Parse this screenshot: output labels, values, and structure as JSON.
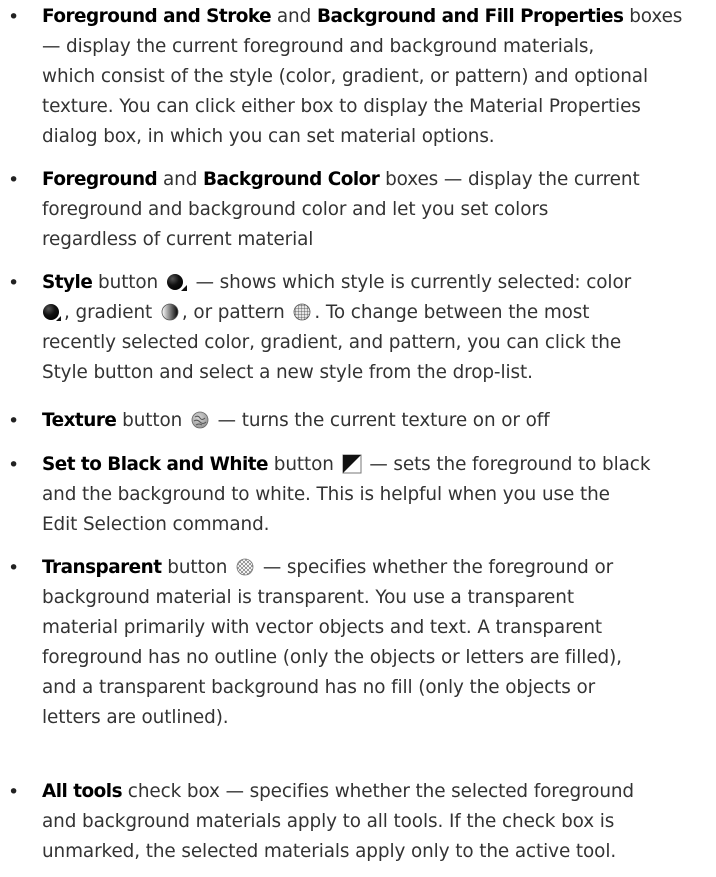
{
  "items": [
    {
      "l1": {
        "t1": "Foreground and Stroke",
        "a": " and ",
        "t2": "Background and Fill Properties",
        "b": " boxes"
      },
      "lines": [
        "— display the current foreground and background materials,",
        "which consist of the style (color, gradient, or pattern) and optional",
        "texture. You can click either box to display the Material Properties",
        "dialog box, in which you can set material options."
      ]
    },
    {
      "l1": {
        "t1": "Foreground",
        "a": " and ",
        "t2": "Background Color",
        "b": " boxes — display the current"
      },
      "lines": [
        "foreground and background color and let you set colors",
        "regardless of current material"
      ]
    },
    {
      "l1": {
        "t1": "Style",
        "a": " button ",
        "b": " — shows which style is currently selected: color"
      },
      "l2": {
        "a": ", gradient ",
        "b": ", or pattern ",
        "c": ". To change between the most"
      },
      "lines": [
        "recently selected color, gradient, and pattern, you can click the",
        "Style button and select a new style from the drop-list."
      ]
    },
    {
      "l1": {
        "t1": "Texture",
        "a": " button ",
        "b": " — turns the current texture on or off"
      }
    },
    {
      "l1": {
        "t1": "Set to Black and White",
        "a": " button ",
        "b": " — sets the foreground to black"
      },
      "lines": [
        "and the background to white. This is helpful when you use the",
        "Edit Selection command."
      ]
    },
    {
      "l1": {
        "t1": "Transparent",
        "a": " button ",
        "b": " — specifies whether the foreground or"
      },
      "lines": [
        "background material is transparent. You use a transparent",
        "material primarily with vector objects and text. A transparent",
        "foreground has no outline (only the objects or letters are filled),",
        "and a transparent background has no fill (only the objects or",
        "letters are outlined)."
      ]
    },
    {
      "l1": {
        "t1": "All tools",
        "b": " check box — specifies whether the selected foreground"
      },
      "lines": [
        "and background materials apply to all tools. If the check box is",
        "unmarked, the selected materials apply only to the active tool."
      ]
    }
  ],
  "bullet_char": "•",
  "icons": [
    "style-color-dropdown-icon",
    "color-style-icon",
    "gradient-style-icon",
    "pattern-style-icon",
    "texture-icon",
    "black-white-icon",
    "transparent-icon"
  ]
}
